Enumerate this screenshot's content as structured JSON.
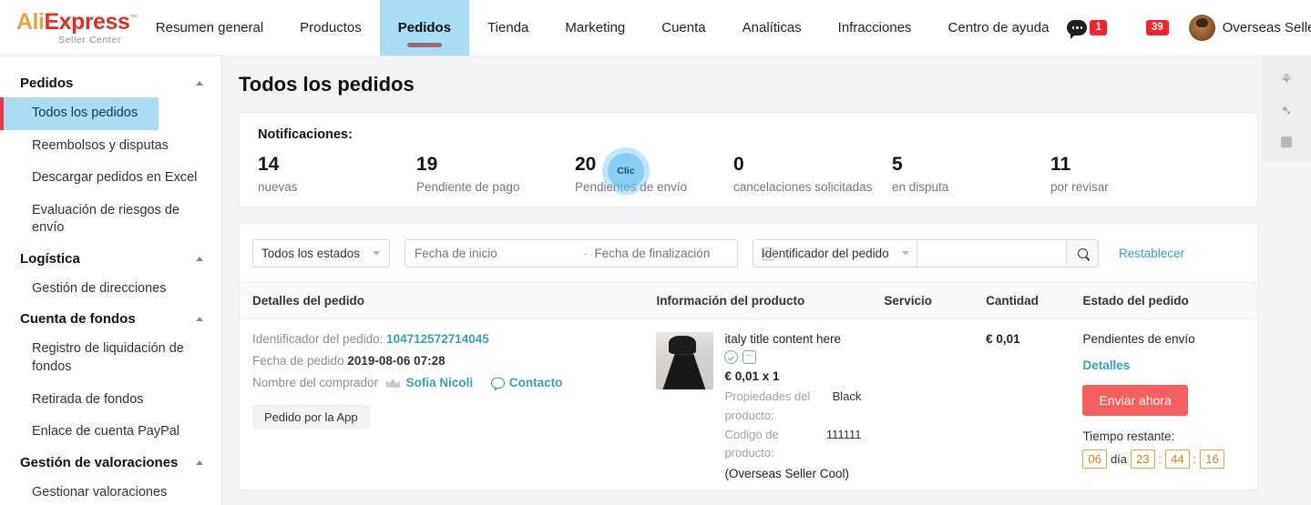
{
  "brand": {
    "name_ali": "Ali",
    "name_e": "E",
    "name_xpress": "xpress",
    "tm": "™",
    "subtitle": "Seller Center"
  },
  "topnav": {
    "items": [
      {
        "label": "Resumen general",
        "active": false
      },
      {
        "label": "Productos",
        "active": false
      },
      {
        "label": "Pedidos",
        "active": true
      },
      {
        "label": "Tienda",
        "active": false
      },
      {
        "label": "Marketing",
        "active": false
      },
      {
        "label": "Cuenta",
        "active": false
      },
      {
        "label": "Analíticas",
        "active": false
      },
      {
        "label": "Infracciones",
        "active": false
      },
      {
        "label": "Centro de ayuda",
        "active": false
      }
    ],
    "message_badge": "1",
    "bell_badge": "39",
    "seller_name": "Overseas Seller",
    "active_color": "#a9ddf2",
    "badge_color": "#f5222d"
  },
  "sidebar": {
    "groups": [
      {
        "title": "Pedidos",
        "items": [
          {
            "label": "Todos los pedidos",
            "active": true
          },
          {
            "label": "Reembolsos y disputas",
            "active": false
          },
          {
            "label": "Descargar pedidos en Excel",
            "active": false
          },
          {
            "label": "Evaluación de riesgos de envío",
            "active": false
          }
        ]
      },
      {
        "title": "Logística",
        "items": [
          {
            "label": "Gestión de direcciones",
            "active": false
          }
        ]
      },
      {
        "title": "Cuenta de fondos",
        "items": [
          {
            "label": "Registro de liquidación de fondos",
            "active": false
          },
          {
            "label": "Retirada de fondos",
            "active": false
          },
          {
            "label": "Enlace de cuenta PayPal",
            "active": false
          }
        ]
      },
      {
        "title": "Gestión de valoraciones",
        "items": [
          {
            "label": "Gestionar valoraciones",
            "active": false
          }
        ]
      }
    ],
    "active_bg": "#a9ddf2",
    "active_border": "#e8394a"
  },
  "page": {
    "title": "Todos los pedidos"
  },
  "notifications": {
    "title": "Notificaciones:",
    "stats": [
      {
        "value": "14",
        "label": "nuevas"
      },
      {
        "value": "19",
        "label": "Pendiente de pago"
      },
      {
        "value": "20",
        "label": "Pendientes de envío"
      },
      {
        "value": "0",
        "label": "cancelaciones solicitadas"
      },
      {
        "value": "5",
        "label": "en disputa"
      },
      {
        "value": "11",
        "label": "por revisar"
      }
    ],
    "click_indicator": {
      "label": "Clic",
      "on_stat_index": 2,
      "color": "#6ec3eb"
    }
  },
  "filters": {
    "status_select": "Todos los estados",
    "date_start_placeholder": "Fecha de inicio",
    "date_separator": "-",
    "date_end_placeholder": "Fecha de finalización",
    "search_select": "Identificador del pedido",
    "search_value": "",
    "search_placeholder": "",
    "reset_label": "Restablecer"
  },
  "table": {
    "headers": {
      "order_details": "Detalles del pedido",
      "product_info": "Información del producto",
      "service": "Servicio",
      "quantity": "Cantidad",
      "order_status": "Estado del pedido"
    },
    "rows": [
      {
        "order_id_label": "Identificador del pedido:",
        "order_id": "104712572714045",
        "order_date_label": "Fecha de pedido",
        "order_date": "2019-08-06 07:28",
        "buyer_label": "Nombre del comprador",
        "buyer_name": "Sofia Nicoli",
        "contact_label": "Contacto",
        "app_tag": "Pedido por la App",
        "product_title": "italy title content here",
        "product_price": "€ 0,01 x 1",
        "prop_key": "Propiedades del producto:",
        "prop_value": "Black",
        "code_key": "Codigo de producto:",
        "code_value": "111111",
        "seller_note": "(Overseas Seller Cool)",
        "service": "",
        "quantity": "€ 0,01",
        "status": "Pendientes de envío",
        "details_link": "Detalles",
        "send_button": "Enviar ahora",
        "time_label": "Tiempo restante:",
        "countdown": {
          "days": "06",
          "day_unit": "día",
          "hours": "23",
          "minutes": "44",
          "seconds": "16",
          "separator": ":"
        }
      }
    ]
  },
  "float_toolbar": {
    "items": [
      {
        "name": "share-icon",
        "glyph": "⚘"
      },
      {
        "name": "rocket-icon",
        "glyph": "➴"
      },
      {
        "name": "calendar-icon",
        "glyph": "▦"
      }
    ]
  }
}
